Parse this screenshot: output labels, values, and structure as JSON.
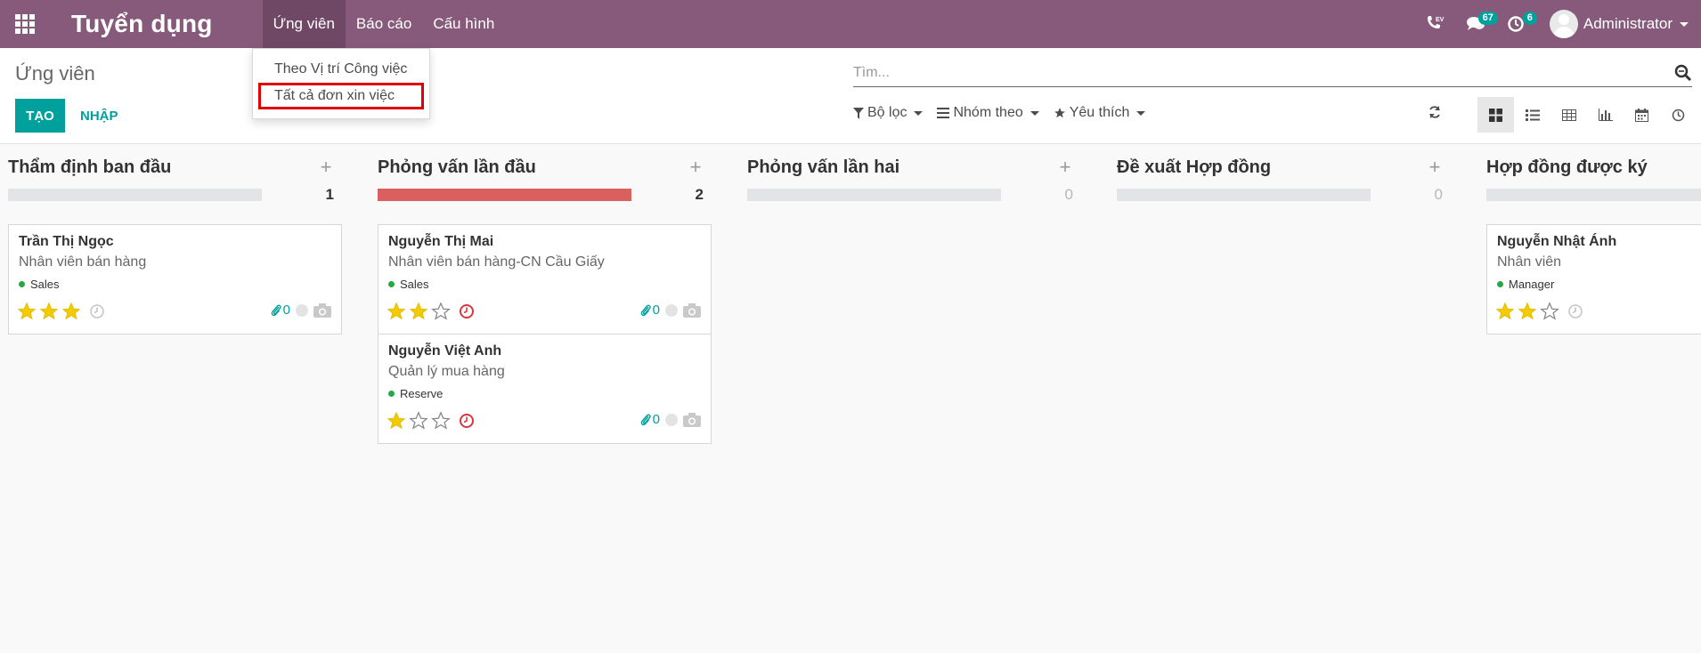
{
  "navbar": {
    "brand": "Tuyển dụng",
    "menu": [
      {
        "label": "Ứng viên"
      },
      {
        "label": "Báo cáo"
      },
      {
        "label": "Cấu hình"
      }
    ],
    "phone_badge": "EV",
    "messages_count": "67",
    "activities_count": "6",
    "user": "Administrator"
  },
  "dropdown": {
    "items": [
      {
        "label": "Theo Vị trí Công việc"
      },
      {
        "label": "Tất cả đơn xin việc"
      }
    ]
  },
  "control": {
    "breadcrumb": "Ứng viên",
    "create_label": "TẠO",
    "import_label": "NHẬP",
    "search_placeholder": "Tìm...",
    "filter_label": "Bộ lọc",
    "groupby_label": "Nhóm theo",
    "favorites_label": "Yêu thích"
  },
  "colors": {
    "brand": "#875a7b",
    "accent": "#00a09d",
    "red_bar": "#d9605f",
    "star": "#f3cc00"
  },
  "columns": [
    {
      "title": "Thẩm định ban đầu",
      "count": "1",
      "cards": [
        {
          "name": "Trần Thị Ngọc",
          "job": "Nhân viên bán hàng",
          "tag": "Sales",
          "stars": 3,
          "overdue": false,
          "attachments": "0"
        }
      ]
    },
    {
      "title": "Phỏng vấn lần đầu",
      "count": "2",
      "cards": [
        {
          "name": "Nguyễn Thị Mai",
          "job": "Nhân viên bán hàng-CN Cầu Giấy",
          "tag": "Sales",
          "stars": 2,
          "overdue": true,
          "attachments": "0"
        },
        {
          "name": "Nguyễn Việt Anh",
          "job": "Quản lý mua hàng",
          "tag": "Reserve",
          "stars": 1,
          "overdue": true,
          "attachments": "0"
        }
      ]
    },
    {
      "title": "Phỏng vấn lần hai",
      "count": "0",
      "cards": []
    },
    {
      "title": "Đề xuất Hợp đồng",
      "count": "0",
      "cards": []
    },
    {
      "title": "Hợp đồng được ký",
      "count": "",
      "cards": [
        {
          "name": "Nguyễn Nhật Ánh",
          "job": "Nhân viên",
          "tag": "Manager",
          "stars": 2,
          "overdue": false,
          "attachments": ""
        }
      ]
    }
  ]
}
